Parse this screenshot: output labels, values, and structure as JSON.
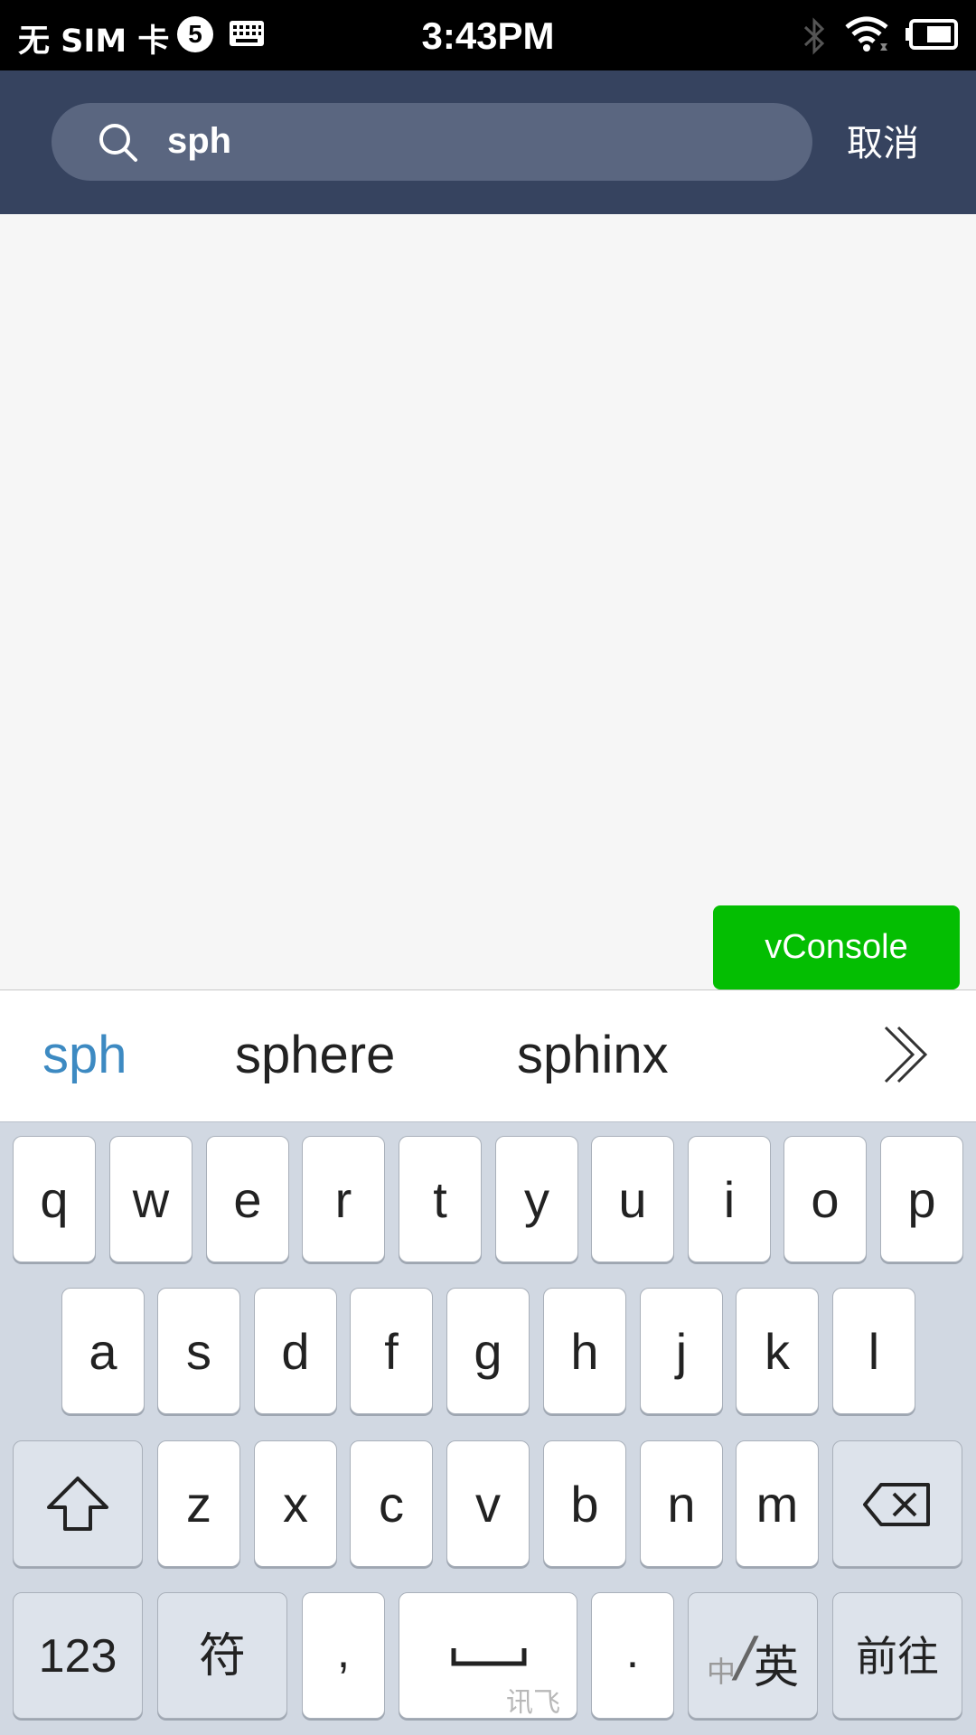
{
  "status_bar": {
    "carrier": "无 SIM 卡",
    "badge_count": "5",
    "time": "3:43PM"
  },
  "search": {
    "value": "sph",
    "cancel_label": "取消"
  },
  "vconsole": {
    "label": "vConsole"
  },
  "suggestions": [
    "sph",
    "sphere",
    "sphinx"
  ],
  "keyboard": {
    "row1": [
      "q",
      "w",
      "e",
      "r",
      "t",
      "y",
      "u",
      "i",
      "o",
      "p"
    ],
    "row2": [
      "a",
      "s",
      "d",
      "f",
      "g",
      "h",
      "j",
      "k",
      "l"
    ],
    "row3": [
      "z",
      "x",
      "c",
      "v",
      "b",
      "n",
      "m"
    ],
    "numbers_label": "123",
    "symbols_label": "符",
    "comma_label": ",",
    "space_brand": "讯飞",
    "period_label": ".",
    "lang_zh": "中",
    "lang_sep": "/",
    "lang_en": "英",
    "go_label": "前往"
  },
  "colors": {
    "header": "#36435f",
    "search_box": "#5a6680",
    "vconsole": "#04be02",
    "suggestion_active": "#3d8ac2",
    "keyboard_bg": "#d1d8e2"
  }
}
